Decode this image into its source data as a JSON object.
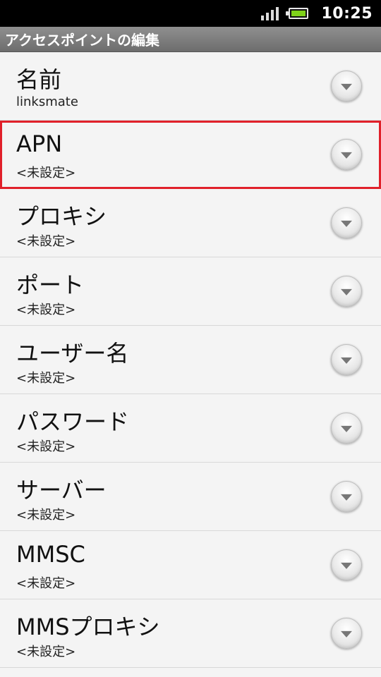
{
  "status": {
    "time": "10:25"
  },
  "title": "アクセスポイントの編集",
  "rows": [
    {
      "title": "名前",
      "value": "linksmate"
    },
    {
      "title": "APN",
      "value": "<未設定>"
    },
    {
      "title": "プロキシ",
      "value": "<未設定>"
    },
    {
      "title": "ポート",
      "value": "<未設定>"
    },
    {
      "title": "ユーザー名",
      "value": "<未設定>"
    },
    {
      "title": "パスワード",
      "value": "<未設定>"
    },
    {
      "title": "サーバー",
      "value": "<未設定>"
    },
    {
      "title": "MMSC",
      "value": "<未設定>"
    },
    {
      "title": "MMSプロキシ",
      "value": "<未設定>"
    }
  ],
  "highlight_color": "#e0202a",
  "accent_battery_color": "#7fd21a"
}
